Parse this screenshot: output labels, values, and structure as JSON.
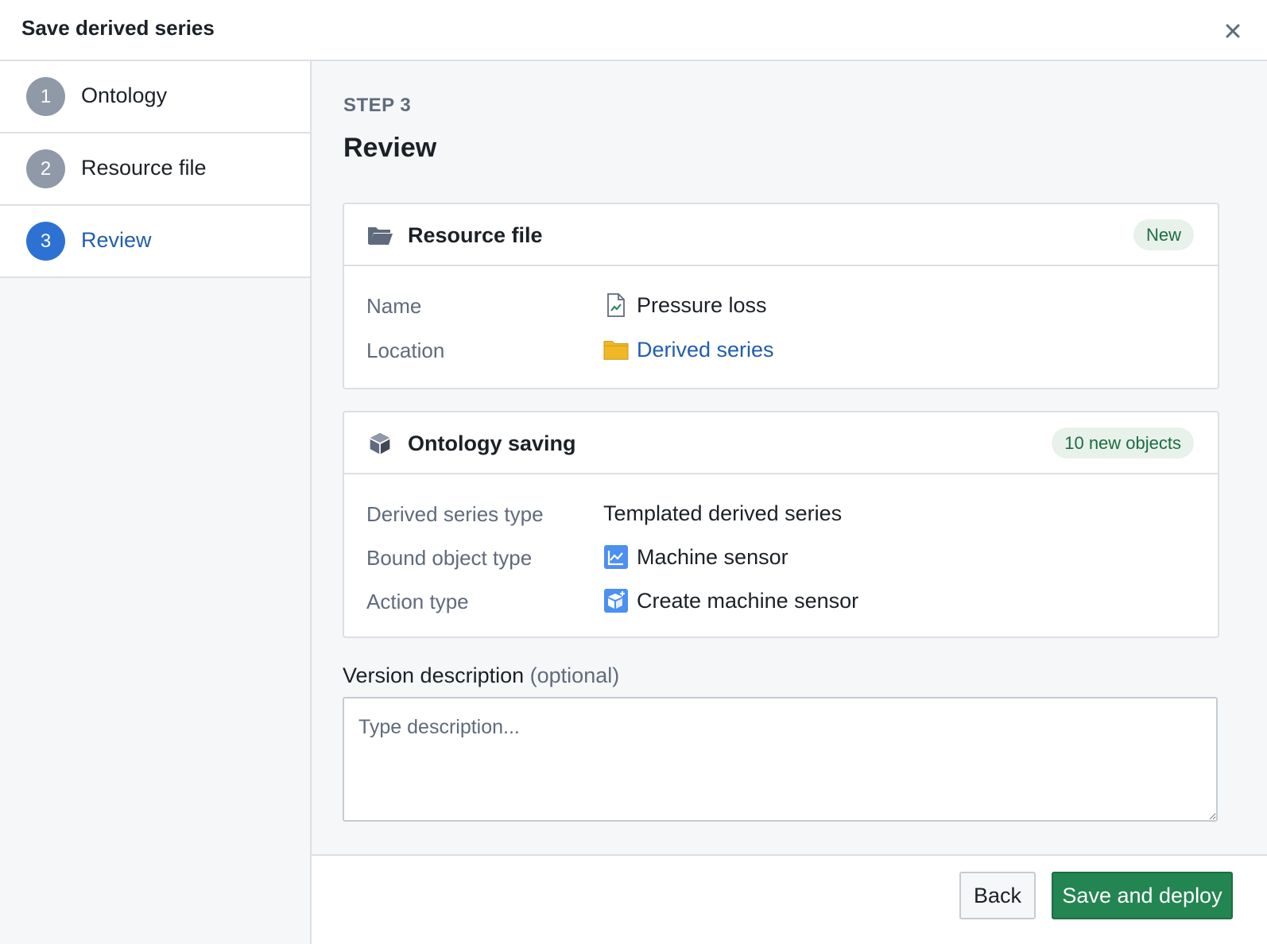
{
  "dialog": {
    "title": "Save derived series",
    "close_icon": "close-icon"
  },
  "steps": [
    {
      "number": "1",
      "label": "Ontology",
      "state": "done"
    },
    {
      "number": "2",
      "label": "Resource file",
      "state": "done"
    },
    {
      "number": "3",
      "label": "Review",
      "state": "active"
    }
  ],
  "main": {
    "kicker": "STEP 3",
    "title": "Review"
  },
  "resource_card": {
    "icon": "folder-open-icon",
    "title": "Resource file",
    "tag": "New",
    "rows": [
      {
        "key": "Name",
        "value": "Pressure loss",
        "icon": "timeseries-file-icon"
      },
      {
        "key": "Location",
        "value": "Derived series",
        "icon": "folder-icon",
        "is_link": true
      }
    ]
  },
  "ontology_card": {
    "icon": "cube-icon",
    "title": "Ontology saving",
    "tag": "10 new objects",
    "rows": [
      {
        "key": "Derived series type",
        "value": "Templated derived series"
      },
      {
        "key": "Bound object type",
        "value": "Machine sensor",
        "icon": "line-chart-icon"
      },
      {
        "key": "Action type",
        "value": "Create machine sensor",
        "icon": "cube-add-icon"
      }
    ]
  },
  "version_description": {
    "label": "Version description",
    "optional_label": "(optional)",
    "placeholder": "Type description...",
    "value": ""
  },
  "footer": {
    "back_label": "Back",
    "primary_label": "Save and deploy"
  },
  "colors": {
    "accent": "#2d72d2",
    "link": "#215db0",
    "success": "#238551",
    "tag_bg": "#e8f1ea",
    "tag_text": "#1c6e42",
    "folder": "#f0b726"
  }
}
